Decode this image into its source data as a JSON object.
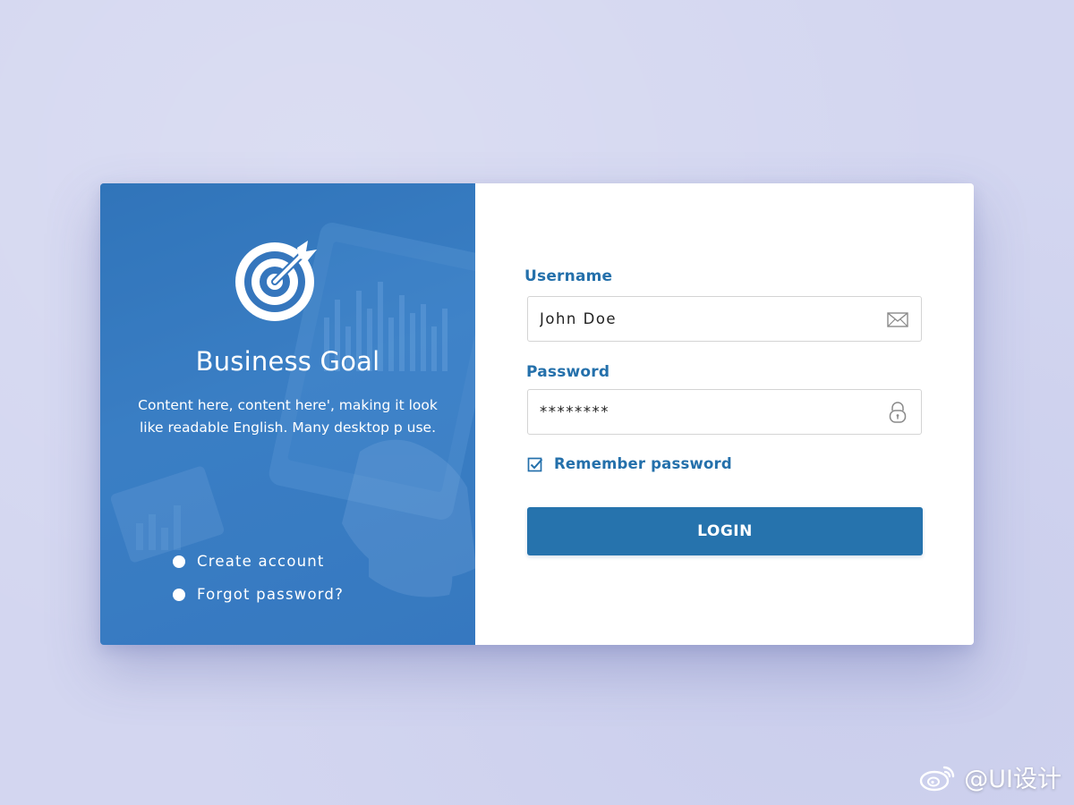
{
  "colors": {
    "page_background": "#d3d6f0",
    "panel_blue": "#3576bd",
    "accent_blue": "#2470ab",
    "button_blue": "#2673ad",
    "input_border": "#d4d4d4"
  },
  "left_panel": {
    "logo_icon": "target-arrow-icon",
    "title": "Business Goal",
    "description": "Content here, content here', making it look like readable English. Many desktop p use.",
    "links": [
      {
        "label": "Create account",
        "icon": "bullet-dot"
      },
      {
        "label": "Forgot password?",
        "icon": "bullet-dot"
      }
    ]
  },
  "login_form": {
    "username": {
      "label": "Username",
      "value": "John Doe",
      "icon": "envelope-icon"
    },
    "password": {
      "label": "Password",
      "value": "********",
      "icon": "padlock-icon"
    },
    "remember": {
      "label": "Remember password",
      "checked": true,
      "icon": "checkbox-checked-icon"
    },
    "submit_label": "LOGIN"
  },
  "watermark": {
    "text": "@UI设计",
    "icon": "weibo-logo-icon"
  }
}
